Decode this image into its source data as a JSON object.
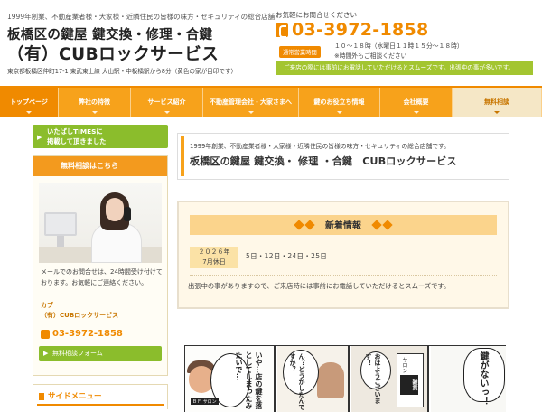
{
  "header": {
    "tagline": "1999年創業、不動産業者様・大家様・近隣住民の皆様の味方・セキュリティの総合店舗",
    "site_title": "板橋区の鍵屋 鍵交換・修理・合鍵",
    "site_name": "（有）CUBロックサービス",
    "address": "東京都板橋区仲町17-1 東武東上線 大山駅・中板橋駅から8分（黄色の家が目印です）"
  },
  "contact": {
    "label": "お気軽にお問合せください",
    "phone": "03-3972-1858",
    "hours_badge": "通常営業時間",
    "hours_line1": "１０～１８時（水曜日１１時１５分～１８時）",
    "hours_line2": "※時間外もご相談ください",
    "notice": "ご来店の際には事前にお電話していただけるとスムーズです。出張中の事が多いです。"
  },
  "nav": {
    "items": [
      {
        "label": "トップページ",
        "width": 65
      },
      {
        "label": "弊社の特徴",
        "width": 80
      },
      {
        "label": "サービス紹介",
        "width": 80
      },
      {
        "label": "不動産管理会社・大家さまへ",
        "width": 106
      },
      {
        "label": "鍵のお役立ち情報",
        "width": 90
      },
      {
        "label": "会社概要",
        "width": 80
      },
      {
        "label": "無料相談",
        "width": 99
      }
    ]
  },
  "sidebar": {
    "times_banner_line1": "いたばしTIMESに",
    "times_banner_line2": "掲載して頂きました",
    "consult_title": "無料相談はこちら",
    "consult_text": "メールでのお問合せは、24時間受け付けております。お気軽にご連絡ください。",
    "company_line1": "カブ",
    "company_line2": "（有）CUBロックサービス",
    "phone": "03-3972-1858",
    "form_button": "無料相談フォーム",
    "side_menu_title": "サイドメニュー"
  },
  "intro": {
    "small": "1999年創業、不動産業者様・大家様・近隣住民の皆様の味方・セキュリティの総合店舗です。",
    "big": "板橋区の鍵屋 鍵交換・ 修理 ・合鍵　CUBロックサービス"
  },
  "news": {
    "title": "新着情報",
    "date_line1": "２０２６年",
    "date_line2": "7月休日",
    "days": "5日・12日・24日・25日",
    "message": "出張中の事がありますので、ご来店時には事前にお電話していただけるとスムーズです。"
  },
  "manga": {
    "p1_text": "いや…店の鍵を落としてしまったみたいで…",
    "p1_sign": "ＢＦ サロン",
    "p2_text": "ん？どうかしたんですか？",
    "p3_text": "おはようございます！",
    "p3_store_top": "サロン",
    "p3_store_sign": "雑貨",
    "p4_text": "鍵がないっ！"
  },
  "colors": {
    "accent_orange": "#f08a00",
    "nav_orange": "#f7a21b",
    "accent_green": "#8bbd2c",
    "notice_green": "#a3c530"
  },
  "icons": {
    "phone": "phone-icon",
    "chevron": "chevron-right-icon",
    "diamond": "diamond-icon"
  }
}
